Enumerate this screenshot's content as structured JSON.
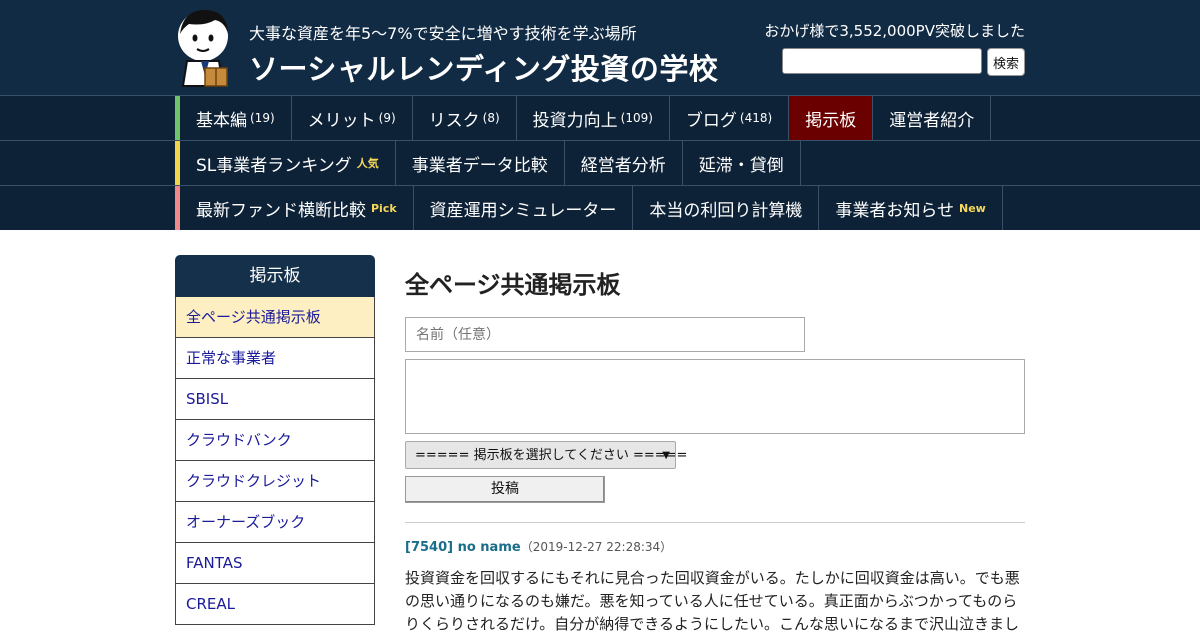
{
  "header": {
    "tagline": "大事な資産を年5～7%で安全に増やす技術を学ぶ場所",
    "site_title": "ソーシャルレンディング投資の学校",
    "pv_notice": "おかげ様で3,552,000PV突破しました",
    "search_placeholder": "",
    "search_button": "検索"
  },
  "nav": {
    "row1": [
      {
        "label": "基本編",
        "count": "(19)"
      },
      {
        "label": "メリット",
        "count": "(9)"
      },
      {
        "label": "リスク",
        "count": "(8)"
      },
      {
        "label": "投資力向上",
        "count": "(109)"
      },
      {
        "label": "ブログ",
        "count": "(418)"
      },
      {
        "label": "掲示板",
        "count": ""
      },
      {
        "label": "運営者紹介",
        "count": ""
      }
    ],
    "row2": [
      {
        "label": "SL事業者ランキング",
        "badge": "人気"
      },
      {
        "label": "事業者データ比較",
        "badge": ""
      },
      {
        "label": "経営者分析",
        "badge": ""
      },
      {
        "label": "延滞・貸倒",
        "badge": ""
      }
    ],
    "row3": [
      {
        "label": "最新ファンド横断比較",
        "badge": "Pick"
      },
      {
        "label": "資産運用シミュレーター",
        "badge": ""
      },
      {
        "label": "本当の利回り計算機",
        "badge": ""
      },
      {
        "label": "事業者お知らせ",
        "badge": "New"
      }
    ],
    "accent_colors": [
      "#6fc36a",
      "#f0d54a",
      "#f08a8a"
    ],
    "active_color": "#6a0000"
  },
  "sidebar": {
    "title": "掲示板",
    "items": [
      "全ページ共通掲示板",
      "正常な事業者",
      "SBISL",
      "クラウドバンク",
      "クラウドクレジット",
      "オーナーズブック",
      "FANTAS",
      "CREAL"
    ]
  },
  "main": {
    "title": "全ページ共通掲示板",
    "name_placeholder": "名前（任意）",
    "board_select": "===== 掲示板を選択してください =====",
    "post_button": "投稿",
    "post": {
      "id": "[7540] no name",
      "date": "（2019-12-27 22:28:34）",
      "body": "投資資金を回収するにもそれに見合った回収資金がいる。たしかに回収資金は高い。でも悪の思い通りになるのも嫌だ。悪を知っている人に任せている。真正面からぶつかってものらりくらりされるだけ。自分が納得できるようにしたい。こんな思いになるまで沢山泣きまし"
    }
  }
}
